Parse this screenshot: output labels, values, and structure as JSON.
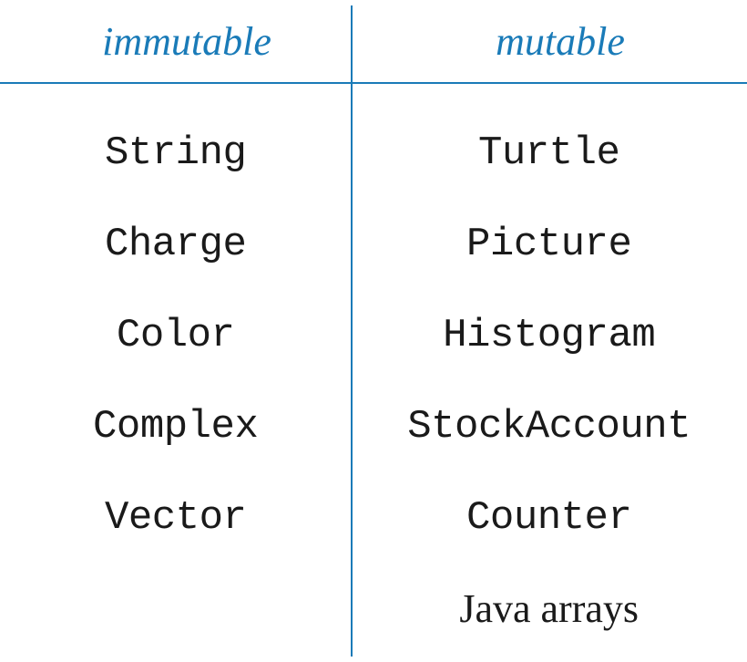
{
  "chart_data": {
    "type": "table",
    "columns": [
      "immutable",
      "mutable"
    ],
    "rows": [
      [
        "String",
        "Turtle"
      ],
      [
        "Charge",
        "Picture"
      ],
      [
        "Color",
        "Histogram"
      ],
      [
        "Complex",
        "StockAccount"
      ],
      [
        "Vector",
        "Counter"
      ],
      [
        "",
        "Java arrays"
      ]
    ]
  },
  "headers": {
    "left": "immutable",
    "right": "mutable"
  },
  "left_column": {
    "r0": "String",
    "r1": "Charge",
    "r2": "Color",
    "r3": "Complex",
    "r4": "Vector"
  },
  "right_column": {
    "r0": "Turtle",
    "r1": "Picture",
    "r2": "Histogram",
    "r3": "StockAccount",
    "r4": "Counter",
    "r5": "Java arrays"
  }
}
